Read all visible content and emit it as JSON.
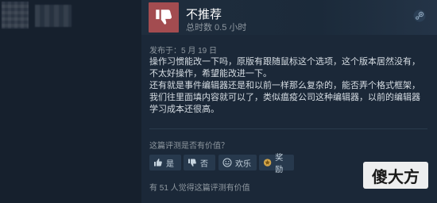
{
  "review": {
    "recommendation": "不推荐",
    "hours": "总时数 0.5 小时",
    "posted": "发布于：5 月 19 日",
    "paragraphs": [
      "操作习惯能改一下吗，原版有跟随鼠标这个选项，这个版本居然没有，不太好操作，希望能改进一下。",
      "还有就是事件编辑器还是和以前一样那么复杂的，能否弄个格式框架，我们往里面填内容就可以了，类似瘟疫公司这种编辑器，以前的编辑器学习成本还很高。"
    ]
  },
  "helpful": {
    "question": "这篇评测是否有价值？",
    "buttons": {
      "yes": "是",
      "no": "否",
      "funny": "欢乐",
      "award": "奖励"
    },
    "found": "有 51 人觉得这篇评测有价值"
  },
  "watermark": "傻大方",
  "colors": {
    "background": "#1b2838",
    "thumb_down_bg": "#a34c50",
    "button_bg": "#27394d"
  }
}
